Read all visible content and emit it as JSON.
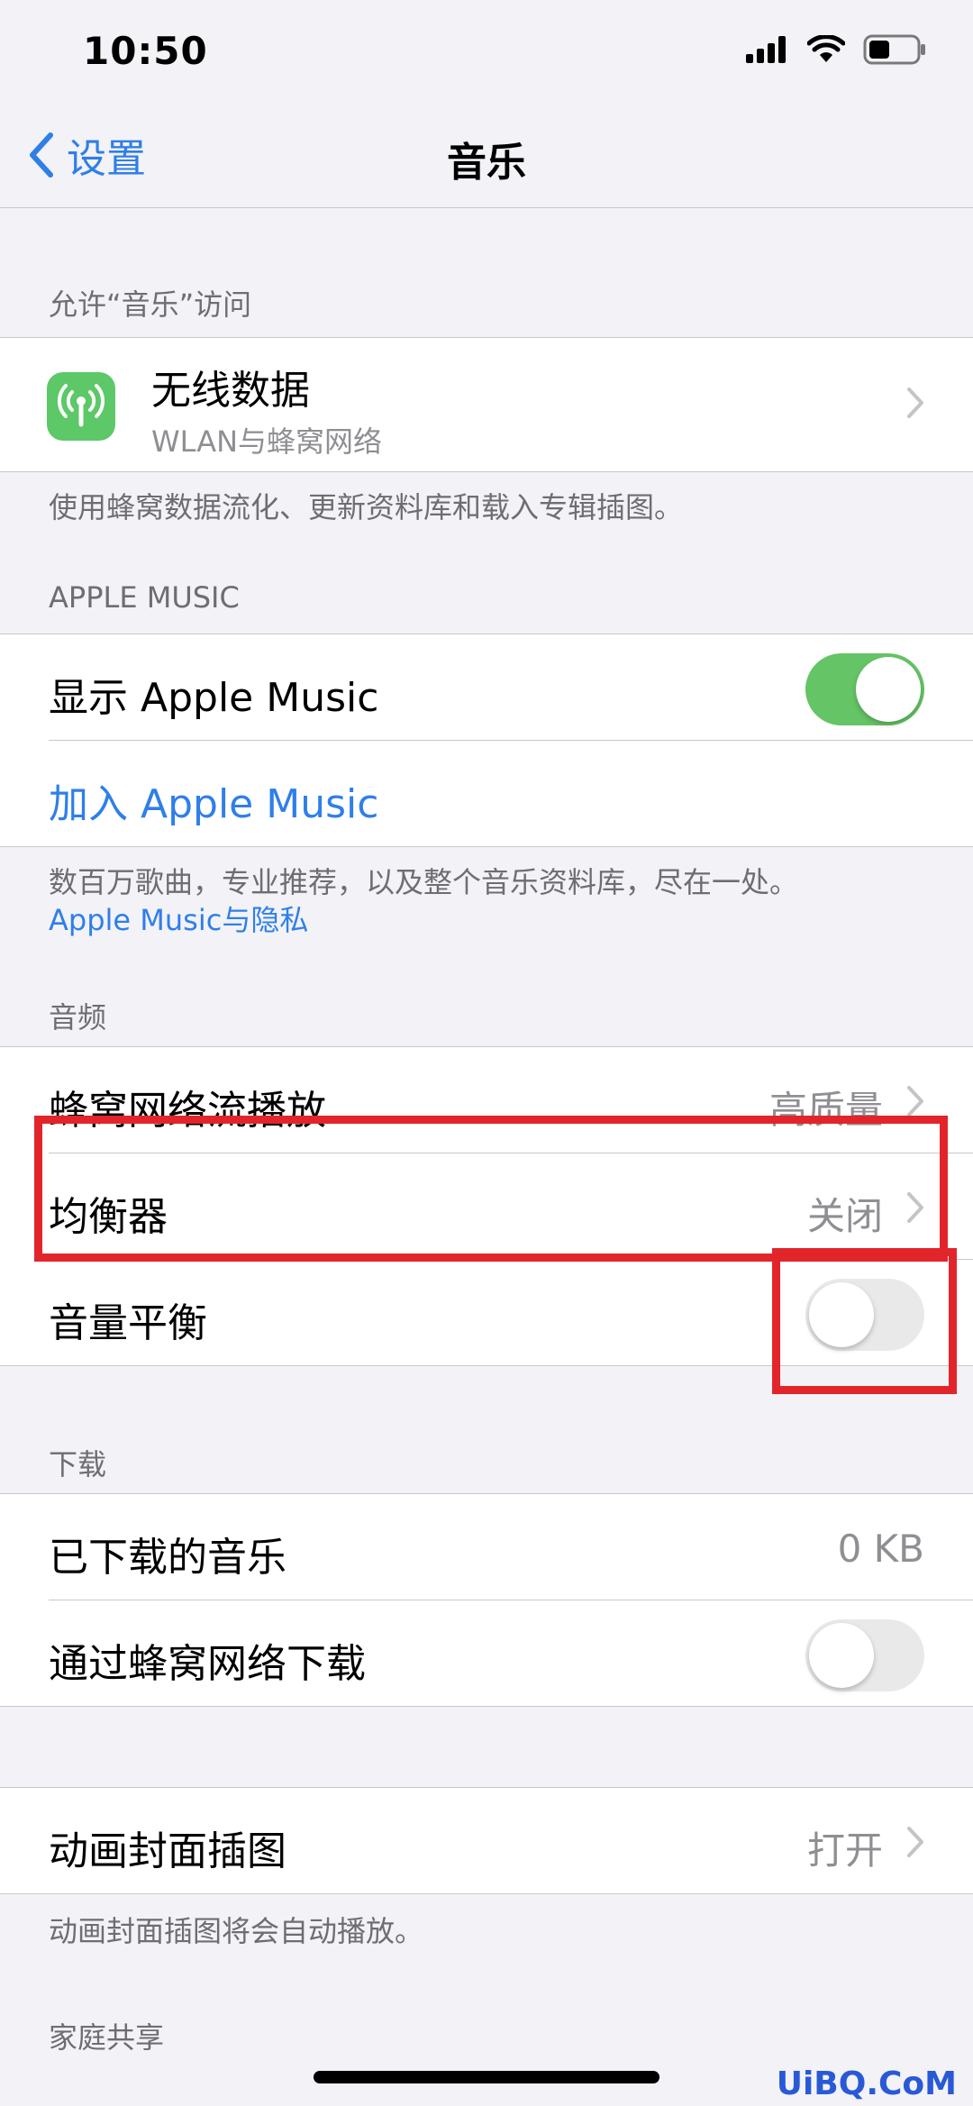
{
  "status_bar": {
    "time": "10:50"
  },
  "nav": {
    "back_label": "设置",
    "title": "音乐"
  },
  "access_section": {
    "header": "允许“音乐”访问",
    "wireless": {
      "title": "无线数据",
      "subtitle": "WLAN与蜂窝网络"
    },
    "footer": "使用蜂窝数据流化、更新资料库和载入专辑插图。"
  },
  "apple_music_section": {
    "header": "APPLE MUSIC",
    "show_label": "显示 Apple Music",
    "show_on": true,
    "join_label": "加入 Apple Music",
    "footer": "数百万歌曲，专业推荐，以及整个音乐资料库，尽在一处。",
    "privacy_link": "Apple Music与隐私"
  },
  "audio_section": {
    "header": "音频",
    "cellular_stream": {
      "label": "蜂窝网络流播放",
      "value": "高质量"
    },
    "equalizer": {
      "label": "均衡器",
      "value": "关闭"
    },
    "volume_balance": {
      "label": "音量平衡",
      "on": false
    }
  },
  "download_section": {
    "header": "下载",
    "downloaded": {
      "label": "已下载的音乐",
      "value": "0 KB"
    },
    "cellular_download": {
      "label": "通过蜂窝网络下载",
      "on": false
    }
  },
  "animated_section": {
    "label": "动画封面插图",
    "value": "打开",
    "footer": "动画封面插图将会自动播放。"
  },
  "family_section": {
    "header": "家庭共享"
  },
  "watermark": "UiBQ.CoM",
  "colors": {
    "accent": "#2f7fe8",
    "toggle_on": "#65c466",
    "highlight": "#e2252b"
  }
}
